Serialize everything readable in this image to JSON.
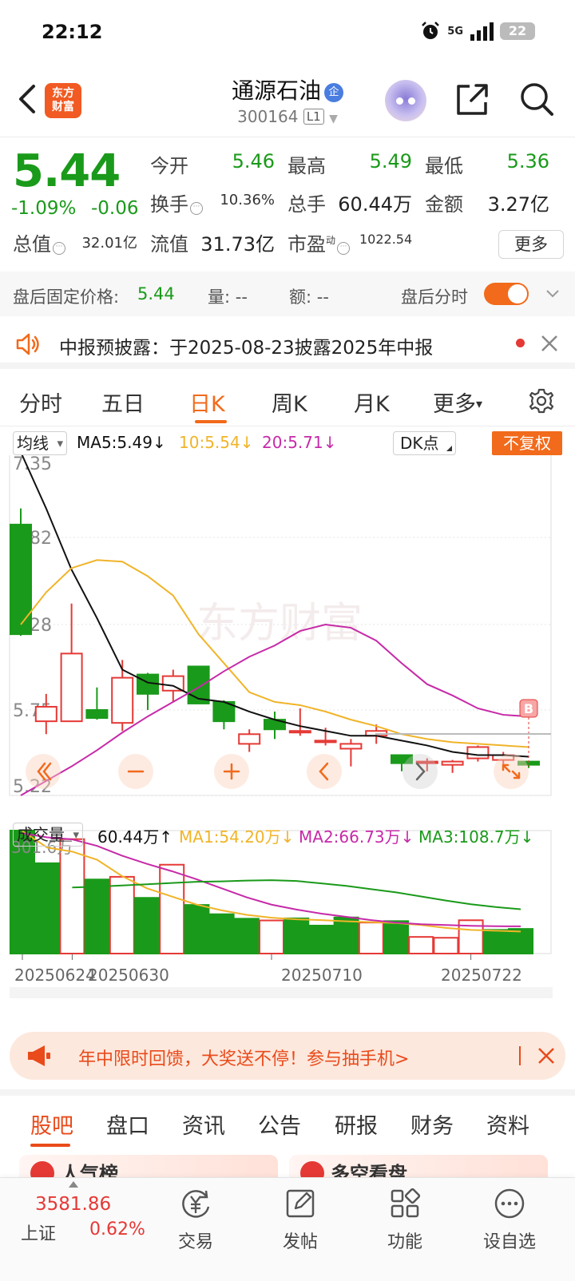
{
  "status_bar": {
    "time": "22:12",
    "network": "5G",
    "battery": "22"
  },
  "header": {
    "logo_text_line1": "东方",
    "logo_text_line2": "财富",
    "stock_name": "通源石油",
    "stock_badge": "企",
    "stock_code": "300164",
    "level_tag": "L1"
  },
  "quote": {
    "price": "5.44",
    "change_pct": "-1.09%",
    "change_amt": "-0.06",
    "stats": [
      {
        "label": "今开",
        "value": "5.46",
        "color": "green"
      },
      {
        "label": "最高",
        "value": "5.49",
        "color": "green"
      },
      {
        "label": "最低",
        "value": "5.36",
        "color": "green"
      },
      {
        "label": "换手",
        "value": "10.36%",
        "color": "dark"
      },
      {
        "label": "总手",
        "value": "60.44万",
        "color": "dark"
      },
      {
        "label": "金额",
        "value": "3.27亿",
        "color": "dark"
      },
      {
        "label": "总值",
        "value": "32.01亿",
        "color": "dark"
      },
      {
        "label": "流值",
        "value": "31.73亿",
        "color": "dark"
      },
      {
        "label": "市盈",
        "value": "1022.54",
        "color": "dark"
      }
    ],
    "pe_superscript": "动",
    "more_label": "更多"
  },
  "after_hours": {
    "fixed_price_label": "盘后固定价格:",
    "fixed_price_value": "5.44",
    "volume_label": "量: --",
    "amount_label": "额: --",
    "timeshare_label": "盘后分时",
    "toggle_on": true
  },
  "notice": {
    "text": "中报预披露：于2025-08-23披露2025年中报"
  },
  "kline_tabs": [
    "分时",
    "五日",
    "日K",
    "周K",
    "月K",
    "更多"
  ],
  "kline_tab_more_arrow": "▾",
  "active_kline_tab": "日K",
  "ma_row": {
    "selector": "均线",
    "ma5": "MA5:5.49",
    "ma10": "10:5.54",
    "ma20": "20:5.71",
    "arrow": "↓",
    "dk_label": "DK点",
    "adjust_label": "不复权"
  },
  "volume_row": {
    "selector": "成交量",
    "volume": "60.44万",
    "volume_arrow": "↑",
    "ma1": "MA1:54.20万",
    "ma2": "MA2:66.73万",
    "ma3": "MA3:108.7万",
    "arrow": "↓"
  },
  "colors": {
    "up": "#e53935",
    "down": "#1a9a1a",
    "accent": "#f26a1b",
    "ma5": "#111111",
    "ma10": "#f0b429",
    "ma20": "#c62aa8",
    "ma3": "#1a9a1a"
  },
  "chart_data": {
    "type": "candlestick",
    "price_axis_ticks": [
      "7.35",
      "6.82",
      "6.28",
      "5.75",
      "5.22"
    ],
    "ylim": [
      5.22,
      7.35
    ],
    "date_labels": [
      "20250624",
      "20250630",
      "20250710",
      "20250722"
    ],
    "buy_marker": "B",
    "watermark": "东方财富",
    "candles": [
      {
        "o": 6.9,
        "h": 7.0,
        "l": 6.21,
        "c": 6.22
      },
      {
        "o": 5.68,
        "h": 5.85,
        "l": 5.6,
        "c": 5.77
      },
      {
        "o": 5.68,
        "h": 6.41,
        "l": 5.68,
        "c": 6.1
      },
      {
        "o": 5.75,
        "h": 5.89,
        "l": 5.69,
        "c": 5.7
      },
      {
        "o": 5.67,
        "h": 6.06,
        "l": 5.62,
        "c": 5.95
      },
      {
        "o": 5.97,
        "h": 5.98,
        "l": 5.75,
        "c": 5.85
      },
      {
        "o": 5.87,
        "h": 6.0,
        "l": 5.8,
        "c": 5.96
      },
      {
        "o": 6.02,
        "h": 6.02,
        "l": 5.79,
        "c": 5.79
      },
      {
        "o": 5.8,
        "h": 5.81,
        "l": 5.63,
        "c": 5.68
      },
      {
        "o": 5.54,
        "h": 5.63,
        "l": 5.49,
        "c": 5.6
      },
      {
        "o": 5.69,
        "h": 5.74,
        "l": 5.57,
        "c": 5.63
      },
      {
        "o": 5.62,
        "h": 5.76,
        "l": 5.59,
        "c": 5.62
      },
      {
        "o": 5.55,
        "h": 5.64,
        "l": 5.53,
        "c": 5.56
      },
      {
        "o": 5.51,
        "h": 5.57,
        "l": 5.4,
        "c": 5.54
      },
      {
        "o": 5.59,
        "h": 5.66,
        "l": 5.54,
        "c": 5.62
      },
      {
        "o": 5.47,
        "h": 5.47,
        "l": 5.37,
        "c": 5.42
      },
      {
        "o": 5.43,
        "h": 5.45,
        "l": 5.37,
        "c": 5.43
      },
      {
        "o": 5.41,
        "h": 5.44,
        "l": 5.36,
        "c": 5.43
      },
      {
        "o": 5.45,
        "h": 5.53,
        "l": 5.43,
        "c": 5.52
      },
      {
        "o": 5.44,
        "h": 5.49,
        "l": 5.41,
        "c": 5.47
      },
      {
        "o": 5.43,
        "h": 5.43,
        "l": 5.39,
        "c": 5.41
      }
    ],
    "ma5_values": [
      7.35,
      7.0,
      6.62,
      6.32,
      6.0,
      5.92,
      5.9,
      5.82,
      5.8,
      5.74,
      5.69,
      5.65,
      5.62,
      5.59,
      5.59,
      5.56,
      5.53,
      5.49,
      5.47,
      5.47,
      5.46
    ],
    "ma10_values": [
      6.28,
      6.48,
      6.63,
      6.68,
      6.67,
      6.58,
      6.46,
      6.22,
      6.04,
      5.86,
      5.8,
      5.78,
      5.74,
      5.69,
      5.65,
      5.6,
      5.57,
      5.55,
      5.54,
      5.53,
      5.52
    ],
    "ma20_values": [
      5.22,
      5.31,
      5.4,
      5.5,
      5.61,
      5.71,
      5.8,
      5.89,
      5.99,
      6.08,
      6.15,
      6.24,
      6.28,
      6.26,
      6.18,
      6.04,
      5.91,
      5.84,
      5.76,
      5.72,
      5.71
    ],
    "volume_axis_top": "301.6万",
    "volume_values": [
      301.6,
      221.5,
      280.6,
      181.6,
      188.2,
      136.6,
      217.9,
      119.2,
      96.5,
      85.5,
      81.2,
      86.3,
      68.6,
      88.6,
      76.1,
      79.6,
      40.8,
      38.7,
      81.7,
      58.1,
      60.44
    ],
    "volume_up": [
      false,
      false,
      true,
      false,
      true,
      false,
      true,
      false,
      false,
      false,
      true,
      false,
      false,
      false,
      true,
      false,
      true,
      true,
      true,
      false,
      false
    ],
    "vol_ma1": [
      300,
      260,
      250,
      230,
      190,
      160,
      140,
      120,
      106,
      95,
      88,
      84,
      82,
      79,
      77,
      75,
      70,
      63,
      58,
      56,
      54.2
    ],
    "vol_ma2": [
      295,
      285,
      280,
      264,
      240,
      220,
      202,
      182,
      160,
      138,
      120,
      108,
      98,
      90,
      82,
      76,
      72,
      70,
      68,
      67,
      66.73
    ],
    "vol_ma3": [
      null,
      null,
      162,
      164,
      167,
      170,
      173,
      176,
      177,
      179,
      180,
      178,
      172,
      166,
      158,
      150,
      140,
      130,
      121,
      114,
      108.7
    ]
  },
  "promo": {
    "text": "年中限时回馈，大奖送不停！参与抽手机>"
  },
  "content_tabs": [
    "股吧",
    "盘口",
    "资讯",
    "公告",
    "研报",
    "财务",
    "资料"
  ],
  "active_content_tab": "股吧",
  "peek_cards": [
    "人气榜",
    "多空看盘"
  ],
  "bottom_nav": {
    "index_value": "3581.86",
    "index_name": "上证",
    "index_pct": "0.62%",
    "items": [
      {
        "label": "交易",
        "icon": "yen-icon"
      },
      {
        "label": "发帖",
        "icon": "compose-icon"
      },
      {
        "label": "功能",
        "icon": "grid-icon"
      },
      {
        "label": "设自选",
        "icon": "more-dots-icon"
      }
    ]
  }
}
